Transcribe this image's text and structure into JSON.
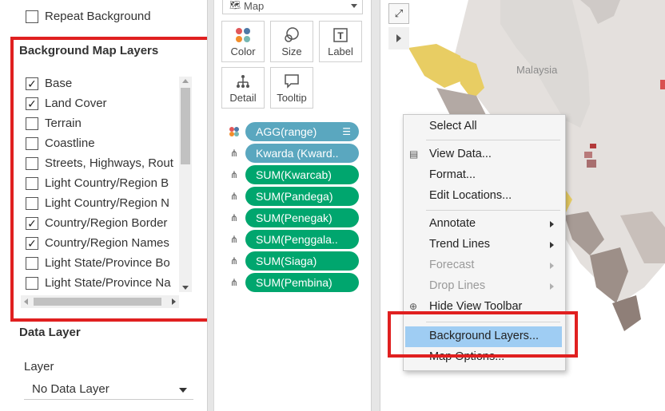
{
  "left_pane": {
    "repeat_background": {
      "label": "Repeat Background",
      "checked": false
    },
    "background_map_layers": {
      "title": "Background Map Layers",
      "items": [
        {
          "label": "Base",
          "checked": true
        },
        {
          "label": "Land Cover",
          "checked": true
        },
        {
          "label": "Terrain",
          "checked": false
        },
        {
          "label": "Coastline",
          "checked": false
        },
        {
          "label": "Streets, Highways, Rout",
          "checked": false
        },
        {
          "label": "Light Country/Region B",
          "checked": false
        },
        {
          "label": "Light Country/Region N",
          "checked": false
        },
        {
          "label": "Country/Region Border",
          "checked": true
        },
        {
          "label": "Country/Region Names",
          "checked": true
        },
        {
          "label": "Light State/Province Bo",
          "checked": false
        },
        {
          "label": "Light State/Province Na",
          "checked": false
        }
      ]
    },
    "data_layer": {
      "title": "Data Layer",
      "layer_label": "Layer",
      "layer_value": "No Data Layer"
    }
  },
  "marks_card": {
    "mark_type": "Map",
    "buttons": [
      {
        "label": "Color",
        "icon": "color-dots-icon"
      },
      {
        "label": "Size",
        "icon": "size-icon"
      },
      {
        "label": "Label",
        "icon": "label-icon"
      },
      {
        "label": "Detail",
        "icon": "detail-icon"
      },
      {
        "label": "Tooltip",
        "icon": "tooltip-icon"
      }
    ],
    "pills": [
      {
        "label": "AGG(range)",
        "role": "color",
        "color": "#5aa7bf",
        "has_sort_icon": true
      },
      {
        "label": "Kwarda (Kward..",
        "role": "detail",
        "color": "#5aa7bf"
      },
      {
        "label": "SUM(Kwarcab)",
        "role": "detail",
        "color": "#00a66e"
      },
      {
        "label": "SUM(Pandega)",
        "role": "detail",
        "color": "#00a66e"
      },
      {
        "label": "SUM(Penegak)",
        "role": "detail",
        "color": "#00a66e"
      },
      {
        "label": "SUM(Penggala..",
        "role": "detail",
        "color": "#00a66e"
      },
      {
        "label": "SUM(Siaga)",
        "role": "detail",
        "color": "#00a66e"
      },
      {
        "label": "SUM(Pembina)",
        "role": "detail",
        "color": "#00a66e"
      }
    ]
  },
  "map": {
    "label_malaysia": "Malaysia"
  },
  "context_menu": {
    "items": [
      {
        "label": "Select All",
        "type": "item"
      },
      {
        "type": "separator"
      },
      {
        "label": "View Data...",
        "type": "item",
        "icon": "view-data-icon"
      },
      {
        "label": "Format...",
        "type": "item"
      },
      {
        "label": "Edit Locations...",
        "type": "item"
      },
      {
        "type": "separator"
      },
      {
        "label": "Annotate",
        "type": "submenu"
      },
      {
        "label": "Trend Lines",
        "type": "submenu"
      },
      {
        "label": "Forecast",
        "type": "submenu",
        "disabled": true
      },
      {
        "label": "Drop Lines",
        "type": "submenu",
        "disabled": true
      },
      {
        "label": "Hide View Toolbar",
        "type": "item",
        "icon": "toolbar-icon"
      },
      {
        "type": "separator"
      },
      {
        "label": "Background Layers...",
        "type": "item",
        "highlighted": true
      },
      {
        "label": "Map Options...",
        "type": "item"
      }
    ]
  },
  "colors": {
    "highlight_box": "#e02020",
    "menu_highlight": "#9fcdf3",
    "pill_blue": "#5aa7bf",
    "pill_green": "#00a66e"
  }
}
